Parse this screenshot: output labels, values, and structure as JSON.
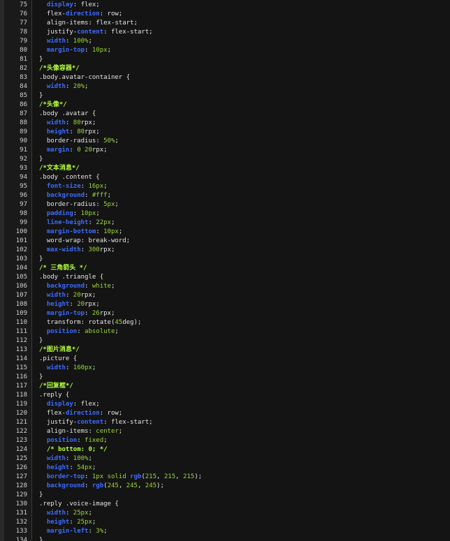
{
  "editor": {
    "lines": [
      {
        "n": "75",
        "segments": [
          [
            "t",
            "  "
          ],
          [
            "p",
            "display"
          ],
          [
            "t",
            ": flex;"
          ]
        ]
      },
      {
        "n": "76",
        "segments": [
          [
            "t",
            "  flex-"
          ],
          [
            "p",
            "direction"
          ],
          [
            "t",
            ": row;"
          ]
        ]
      },
      {
        "n": "77",
        "segments": [
          [
            "t",
            "  align-items: flex-start;"
          ]
        ]
      },
      {
        "n": "78",
        "segments": [
          [
            "t",
            "  justify-"
          ],
          [
            "p",
            "content"
          ],
          [
            "t",
            ": flex-start;"
          ]
        ]
      },
      {
        "n": "79",
        "segments": [
          [
            "t",
            "  "
          ],
          [
            "p",
            "width"
          ],
          [
            "t",
            ": "
          ],
          [
            "v",
            "100%"
          ],
          [
            "t",
            ";"
          ]
        ]
      },
      {
        "n": "80",
        "segments": [
          [
            "t",
            "  "
          ],
          [
            "p",
            "margin-top"
          ],
          [
            "t",
            ": "
          ],
          [
            "v",
            "10px"
          ],
          [
            "t",
            ";"
          ]
        ]
      },
      {
        "n": "81",
        "segments": [
          [
            "t",
            "}"
          ]
        ]
      },
      {
        "n": "82",
        "segments": [
          [
            "c",
            "/*头像容器*/"
          ]
        ]
      },
      {
        "n": "83",
        "segments": [
          [
            "t",
            ".body.avatar-container {"
          ]
        ]
      },
      {
        "n": "84",
        "segments": [
          [
            "t",
            "  "
          ],
          [
            "p",
            "width"
          ],
          [
            "t",
            ": "
          ],
          [
            "v",
            "20%"
          ],
          [
            "t",
            ";"
          ]
        ]
      },
      {
        "n": "85",
        "segments": [
          [
            "t",
            "}"
          ]
        ]
      },
      {
        "n": "86",
        "segments": [
          [
            "c",
            "/*头像*/"
          ]
        ]
      },
      {
        "n": "87",
        "segments": [
          [
            "t",
            ".body .avatar {"
          ]
        ]
      },
      {
        "n": "88",
        "segments": [
          [
            "t",
            "  "
          ],
          [
            "p",
            "width"
          ],
          [
            "t",
            ": "
          ],
          [
            "v",
            "80"
          ],
          [
            "t",
            "rpx;"
          ]
        ]
      },
      {
        "n": "89",
        "segments": [
          [
            "t",
            "  "
          ],
          [
            "p",
            "height"
          ],
          [
            "t",
            ": "
          ],
          [
            "v",
            "80"
          ],
          [
            "t",
            "rpx;"
          ]
        ]
      },
      {
        "n": "90",
        "segments": [
          [
            "t",
            "  border-radius: "
          ],
          [
            "v",
            "50%"
          ],
          [
            "t",
            ";"
          ]
        ]
      },
      {
        "n": "91",
        "segments": [
          [
            "t",
            "  "
          ],
          [
            "p",
            "margin"
          ],
          [
            "t",
            ": "
          ],
          [
            "v",
            "0 20"
          ],
          [
            "t",
            "rpx;"
          ]
        ]
      },
      {
        "n": "92",
        "segments": [
          [
            "t",
            "}"
          ]
        ]
      },
      {
        "n": "93",
        "segments": [
          [
            "c",
            "/*文本消息*/"
          ]
        ]
      },
      {
        "n": "94",
        "segments": [
          [
            "t",
            ".body .content {"
          ]
        ]
      },
      {
        "n": "95",
        "segments": [
          [
            "t",
            "  "
          ],
          [
            "p",
            "font-size"
          ],
          [
            "t",
            ": "
          ],
          [
            "v",
            "16px"
          ],
          [
            "t",
            ";"
          ]
        ]
      },
      {
        "n": "96",
        "segments": [
          [
            "t",
            "  "
          ],
          [
            "p",
            "background"
          ],
          [
            "t",
            ": "
          ],
          [
            "v",
            "#fff"
          ],
          [
            "t",
            ";"
          ]
        ]
      },
      {
        "n": "97",
        "segments": [
          [
            "t",
            "  border-radius: "
          ],
          [
            "v",
            "5px"
          ],
          [
            "t",
            ";"
          ]
        ]
      },
      {
        "n": "98",
        "segments": [
          [
            "t",
            "  "
          ],
          [
            "p",
            "padding"
          ],
          [
            "t",
            ": "
          ],
          [
            "v",
            "10px"
          ],
          [
            "t",
            ";"
          ]
        ]
      },
      {
        "n": "99",
        "segments": [
          [
            "t",
            "  "
          ],
          [
            "p",
            "line-height"
          ],
          [
            "t",
            ": "
          ],
          [
            "v",
            "22px"
          ],
          [
            "t",
            ";"
          ]
        ]
      },
      {
        "n": "100",
        "segments": [
          [
            "t",
            "  "
          ],
          [
            "p",
            "margin-bottom"
          ],
          [
            "t",
            ": "
          ],
          [
            "v",
            "10px"
          ],
          [
            "t",
            ";"
          ]
        ]
      },
      {
        "n": "101",
        "segments": [
          [
            "t",
            "  word-wrap: break-word;"
          ]
        ]
      },
      {
        "n": "102",
        "segments": [
          [
            "t",
            "  "
          ],
          [
            "p",
            "max-width"
          ],
          [
            "t",
            ": "
          ],
          [
            "v",
            "300"
          ],
          [
            "t",
            "rpx;"
          ]
        ]
      },
      {
        "n": "103",
        "segments": [
          [
            "t",
            "}"
          ]
        ]
      },
      {
        "n": "104",
        "segments": [
          [
            "c",
            "/* 三角箭头 */"
          ]
        ]
      },
      {
        "n": "105",
        "segments": [
          [
            "t",
            ".body .triangle {"
          ]
        ]
      },
      {
        "n": "106",
        "segments": [
          [
            "t",
            "  "
          ],
          [
            "p",
            "background"
          ],
          [
            "t",
            ": "
          ],
          [
            "v",
            "white"
          ],
          [
            "t",
            ";"
          ]
        ]
      },
      {
        "n": "107",
        "segments": [
          [
            "t",
            "  "
          ],
          [
            "p",
            "width"
          ],
          [
            "t",
            ": "
          ],
          [
            "v",
            "20"
          ],
          [
            "t",
            "rpx;"
          ]
        ]
      },
      {
        "n": "108",
        "segments": [
          [
            "t",
            "  "
          ],
          [
            "p",
            "height"
          ],
          [
            "t",
            ": "
          ],
          [
            "v",
            "20"
          ],
          [
            "t",
            "rpx;"
          ]
        ]
      },
      {
        "n": "109",
        "segments": [
          [
            "t",
            "  "
          ],
          [
            "p",
            "margin-top"
          ],
          [
            "t",
            ": "
          ],
          [
            "v",
            "26"
          ],
          [
            "t",
            "rpx;"
          ]
        ]
      },
      {
        "n": "110",
        "segments": [
          [
            "t",
            "  transform: rotate("
          ],
          [
            "v",
            "45"
          ],
          [
            "t",
            "deg);"
          ]
        ]
      },
      {
        "n": "111",
        "segments": [
          [
            "t",
            "  "
          ],
          [
            "p",
            "position"
          ],
          [
            "t",
            ": "
          ],
          [
            "v",
            "absolute"
          ],
          [
            "t",
            ";"
          ]
        ]
      },
      {
        "n": "112",
        "segments": [
          [
            "t",
            "}"
          ]
        ]
      },
      {
        "n": "113",
        "segments": [
          [
            "c",
            "/*图片消息*/"
          ]
        ]
      },
      {
        "n": "114",
        "segments": [
          [
            "t",
            ".picture {"
          ]
        ]
      },
      {
        "n": "115",
        "segments": [
          [
            "t",
            "  "
          ],
          [
            "p",
            "width"
          ],
          [
            "t",
            ": "
          ],
          [
            "v",
            "160px"
          ],
          [
            "t",
            ";"
          ]
        ]
      },
      {
        "n": "116",
        "segments": [
          [
            "t",
            "}"
          ]
        ]
      },
      {
        "n": "117",
        "segments": [
          [
            "c",
            "/*回复框*/"
          ]
        ]
      },
      {
        "n": "118",
        "segments": [
          [
            "t",
            ".reply {"
          ]
        ]
      },
      {
        "n": "119",
        "segments": [
          [
            "t",
            "  "
          ],
          [
            "p",
            "display"
          ],
          [
            "t",
            ": flex;"
          ]
        ]
      },
      {
        "n": "120",
        "segments": [
          [
            "t",
            "  flex-"
          ],
          [
            "p",
            "direction"
          ],
          [
            "t",
            ": row;"
          ]
        ]
      },
      {
        "n": "121",
        "segments": [
          [
            "t",
            "  justify-"
          ],
          [
            "p",
            "content"
          ],
          [
            "t",
            ": flex-start;"
          ]
        ]
      },
      {
        "n": "122",
        "segments": [
          [
            "t",
            "  align-items: "
          ],
          [
            "v",
            "center"
          ],
          [
            "t",
            ";"
          ]
        ]
      },
      {
        "n": "123",
        "segments": [
          [
            "t",
            "  "
          ],
          [
            "p",
            "position"
          ],
          [
            "t",
            ": "
          ],
          [
            "v",
            "fixed"
          ],
          [
            "t",
            ";"
          ]
        ]
      },
      {
        "n": "124",
        "segments": [
          [
            "t",
            "  "
          ],
          [
            "c",
            "/* bottom: 0; */"
          ]
        ]
      },
      {
        "n": "125",
        "segments": [
          [
            "t",
            "  "
          ],
          [
            "p",
            "width"
          ],
          [
            "t",
            ": "
          ],
          [
            "v",
            "100%"
          ],
          [
            "t",
            ";"
          ]
        ]
      },
      {
        "n": "126",
        "segments": [
          [
            "t",
            "  "
          ],
          [
            "p",
            "height"
          ],
          [
            "t",
            ": "
          ],
          [
            "v",
            "54px"
          ],
          [
            "t",
            ";"
          ]
        ]
      },
      {
        "n": "127",
        "segments": [
          [
            "t",
            "  "
          ],
          [
            "p",
            "border-top"
          ],
          [
            "t",
            ": "
          ],
          [
            "v",
            "1px solid "
          ],
          [
            "p",
            "rgb"
          ],
          [
            "t",
            "("
          ],
          [
            "v",
            "215"
          ],
          [
            "t",
            ", "
          ],
          [
            "v",
            "215"
          ],
          [
            "t",
            ", "
          ],
          [
            "v",
            "215"
          ],
          [
            "t",
            ");"
          ]
        ]
      },
      {
        "n": "128",
        "segments": [
          [
            "t",
            "  "
          ],
          [
            "p",
            "background"
          ],
          [
            "t",
            ": "
          ],
          [
            "p",
            "rgb"
          ],
          [
            "t",
            "("
          ],
          [
            "v",
            "245"
          ],
          [
            "t",
            ", "
          ],
          [
            "v",
            "245"
          ],
          [
            "t",
            ", "
          ],
          [
            "v",
            "245"
          ],
          [
            "t",
            ");"
          ]
        ]
      },
      {
        "n": "129",
        "segments": [
          [
            "t",
            "}"
          ]
        ]
      },
      {
        "n": "130",
        "segments": [
          [
            "t",
            ".reply .voice-image {"
          ]
        ]
      },
      {
        "n": "131",
        "segments": [
          [
            "t",
            "  "
          ],
          [
            "p",
            "width"
          ],
          [
            "t",
            ": "
          ],
          [
            "v",
            "25px"
          ],
          [
            "t",
            ";"
          ]
        ]
      },
      {
        "n": "132",
        "segments": [
          [
            "t",
            "  "
          ],
          [
            "p",
            "height"
          ],
          [
            "t",
            ": "
          ],
          [
            "v",
            "25px"
          ],
          [
            "t",
            ";"
          ]
        ]
      },
      {
        "n": "133",
        "segments": [
          [
            "t",
            "  "
          ],
          [
            "p",
            "margin-left"
          ],
          [
            "t",
            ": "
          ],
          [
            "v",
            "3%"
          ],
          [
            "t",
            ";"
          ]
        ]
      },
      {
        "n": "134",
        "segments": [
          [
            "t",
            "}"
          ]
        ]
      }
    ]
  }
}
